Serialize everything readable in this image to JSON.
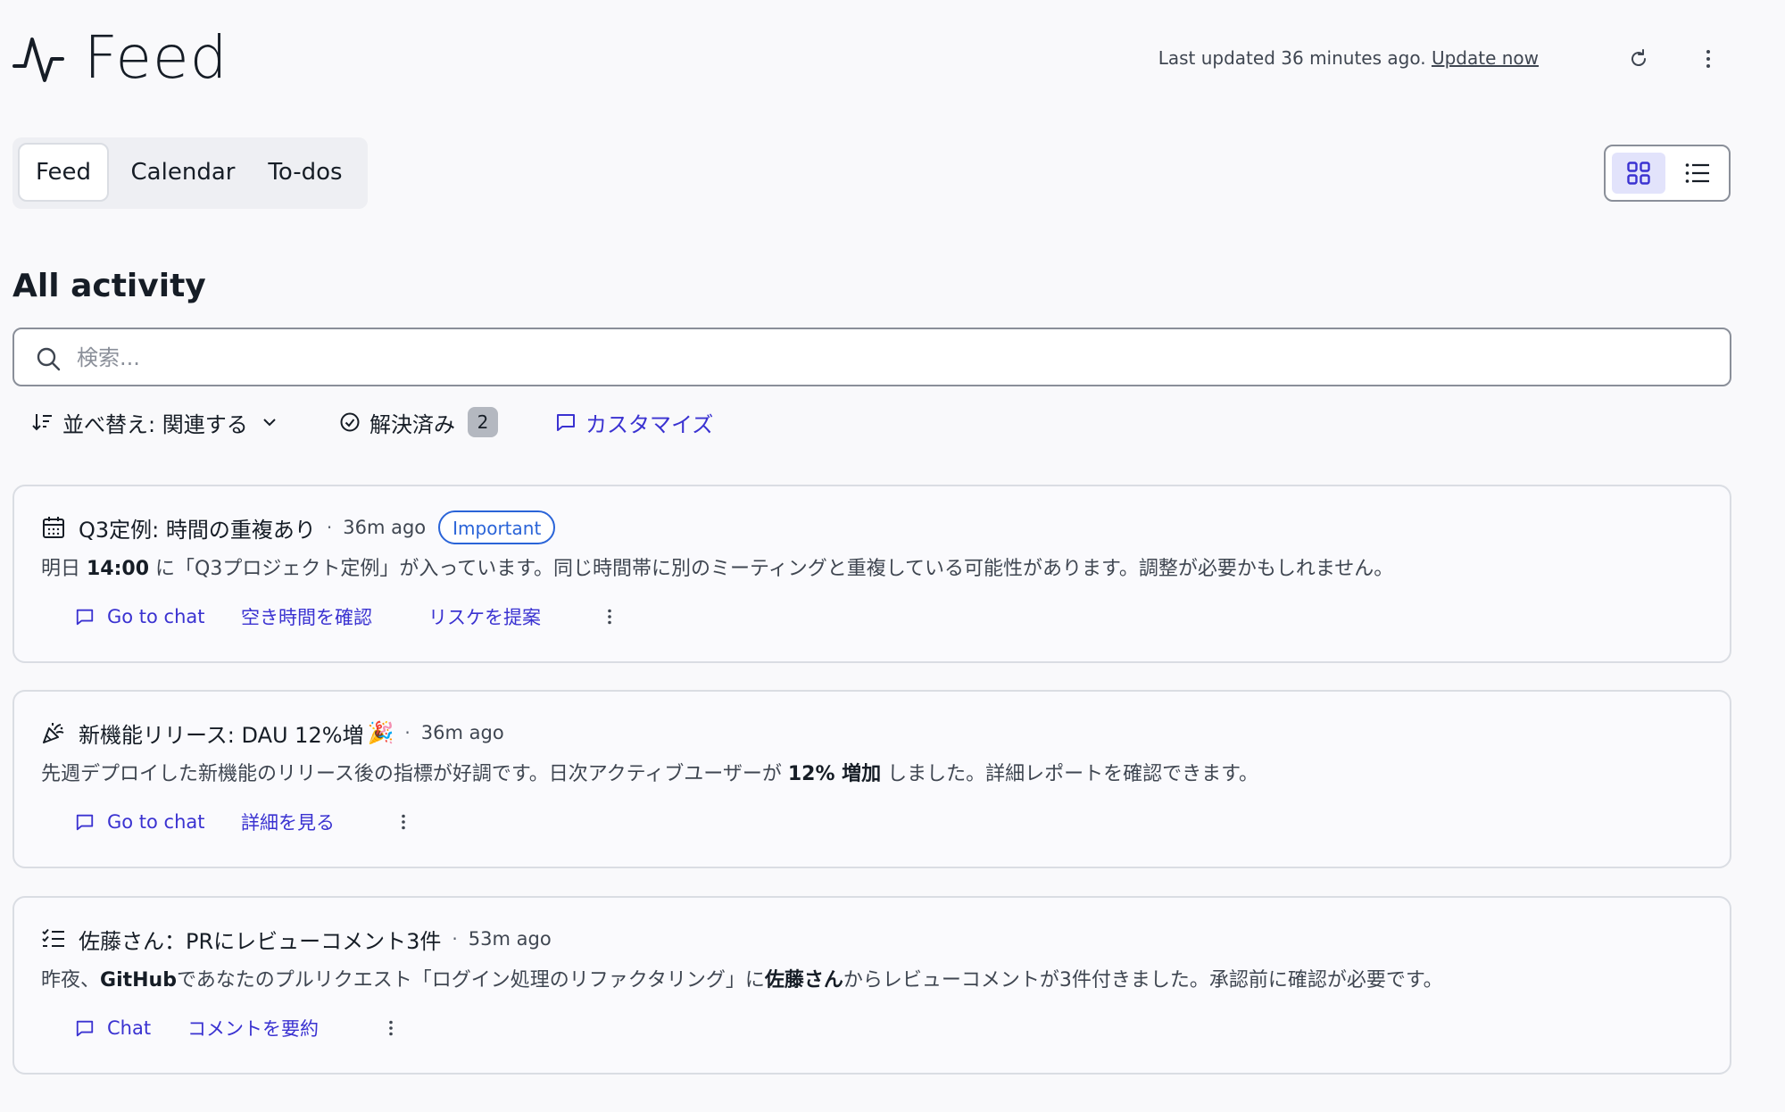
{
  "header": {
    "title": "Feed",
    "last_updated": "Last updated 36 minutes ago.",
    "update_now": "Update now"
  },
  "tabs": [
    {
      "label": "Feed",
      "active": true
    },
    {
      "label": "Calendar",
      "active": false
    },
    {
      "label": "To-dos",
      "active": false
    }
  ],
  "view_toggle": {
    "active": "grid"
  },
  "section": {
    "title": "All activity",
    "search_placeholder": "検索..."
  },
  "filters": {
    "sort_label": "並べ替え: 関連する",
    "resolved_label": "解決済み",
    "resolved_count": "2",
    "customize_label": "カスタマイズ"
  },
  "cards": [
    {
      "icon": "calendar-icon",
      "title": "Q3定例: 時間の重複あり",
      "time": "36m ago",
      "badge": "Important",
      "body_pre": "明日 ",
      "body_bold": "14:00",
      "body_post": " に「Q3プロジェクト定例」が入っています。同じ時間帯に別のミーティングと重複している可能性があります。調整が必要かもしれません。",
      "actions": [
        "Go to chat",
        "空き時間を確認",
        "リスケを提案"
      ]
    },
    {
      "icon": "party-popper-icon",
      "title": "新機能リリース: DAU 12%増",
      "title_emoji": "🎉",
      "time": "36m ago",
      "body_pre": "先週デプロイした新機能のリリース後の指標が好調です。日次アクティブユーザーが ",
      "body_bold": "12% 増加",
      "body_post": " しました。詳細レポートを確認できます。",
      "actions": [
        "Go to chat",
        "詳細を見る"
      ]
    },
    {
      "icon": "checklist-icon",
      "title": "佐藤さん：PRにレビューコメント3件",
      "time": "53m ago",
      "body_pre": "昨夜、",
      "body_bold": "GitHub",
      "body_mid": "であなたのプルリクエスト「ログイン処理のリファクタリング」に",
      "body_bold2": "佐藤さん",
      "body_post": "からレビューコメントが3件付きました。承認前に確認が必要です。",
      "actions": [
        "Chat",
        "コメントを要約"
      ]
    }
  ],
  "colors": {
    "accent": "#3a32d1",
    "badge_blue": "#2a64d8",
    "background": "#f9f9fb",
    "text": "#161d26"
  }
}
